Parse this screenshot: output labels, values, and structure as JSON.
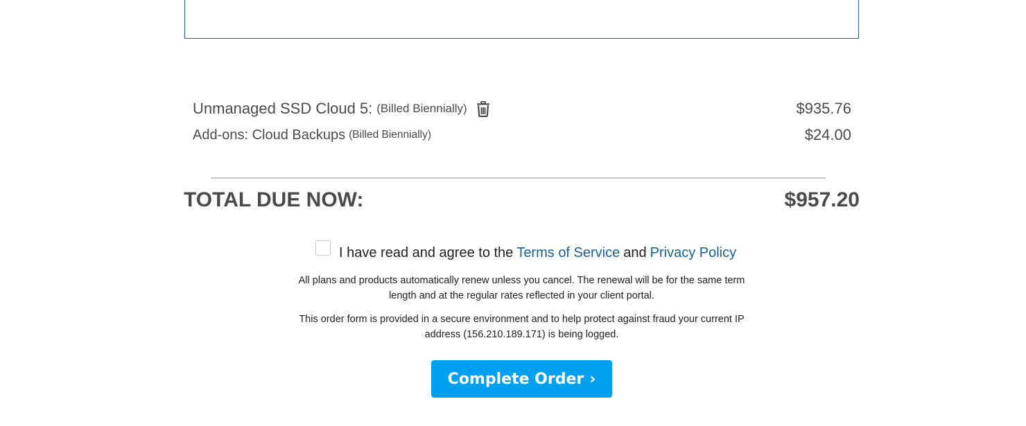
{
  "order": {
    "items": [
      {
        "name": "Unmanaged SSD Cloud 5:",
        "cycle": "(Billed Biennially)",
        "price": "$935.76"
      },
      {
        "name": "Add-ons: Cloud Backups",
        "cycle": "(Billed Biennially)",
        "price": "$24.00"
      }
    ],
    "total_label": "TOTAL DUE NOW:",
    "total_value": "$957.20"
  },
  "agreement": {
    "prefix": "I have read and agree to the",
    "terms_link": "Terms of Service",
    "and": "and",
    "privacy_link": "Privacy Policy",
    "checked": false
  },
  "notices": {
    "renewal": "All plans and products automatically renew unless you cancel. The renewal will be for the same term length and at the regular rates reflected in your client portal.",
    "security": "This order form is provided in a secure environment and to help protect against fraud your current IP address (156.210.189.171) is being logged."
  },
  "actions": {
    "complete_label": "Complete Order",
    "complete_chevron": "›"
  },
  "icons": {
    "remove_item": "trash-icon",
    "complete_arrow": "chevron-right-icon"
  },
  "colors": {
    "box_border": "#2f56a6",
    "link": "#1a5f8f",
    "button": "#00a0f0",
    "text": "#4a4a4a"
  }
}
